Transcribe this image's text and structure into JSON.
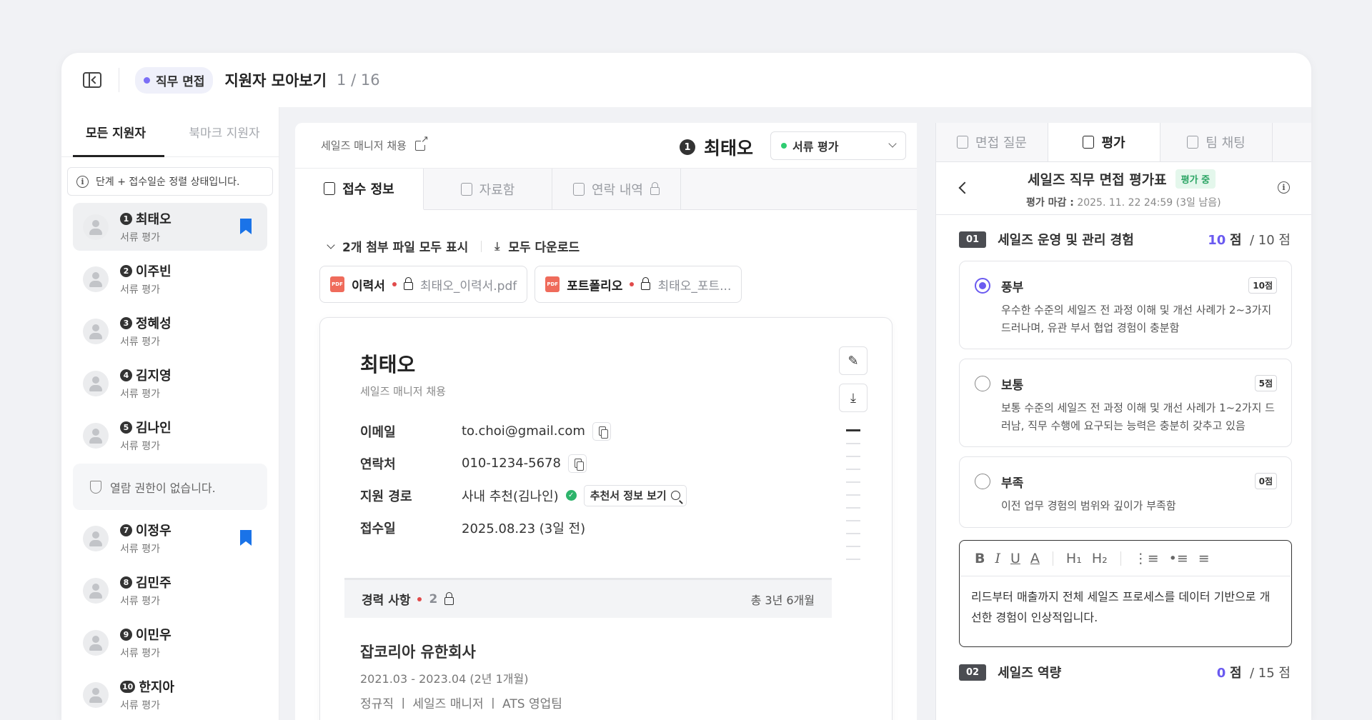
{
  "topbar": {
    "stage_chip": "직무 면접",
    "title": "지원자 모아보기",
    "counter": "1 / 16"
  },
  "sidebar": {
    "tabs": [
      "모든 지원자",
      "북마크 지원자"
    ],
    "sort_note": "단계 + 접수일순 정렬 상태입니다.",
    "applicants": [
      {
        "num": "1",
        "name": "최태오",
        "status": "서류 평가",
        "bookmarked": true,
        "selected": true
      },
      {
        "num": "2",
        "name": "이주빈",
        "status": "서류 평가"
      },
      {
        "num": "3",
        "name": "정혜성",
        "status": "서류 평가"
      },
      {
        "num": "4",
        "name": "김지영",
        "status": "서류 평가"
      },
      {
        "num": "5",
        "name": "김나인",
        "status": "서류 평가"
      },
      {
        "num": "7",
        "name": "이정우",
        "status": "서류 평가",
        "bookmarked": true
      },
      {
        "num": "8",
        "name": "김민주",
        "status": "서류 평가"
      },
      {
        "num": "9",
        "name": "이민우",
        "status": "서류 평가"
      },
      {
        "num": "10",
        "name": "한지아",
        "status": "서류 평가"
      }
    ],
    "no_permission": "열람 권한이 없습니다."
  },
  "center": {
    "job": "세일즈 매니저 채용",
    "applicant_num": "1",
    "applicant_name": "최태오",
    "status_select": "서류 평가",
    "tabs": [
      "접수 정보",
      "자료함",
      "연락 내역"
    ],
    "attach_toggle": "2개 첨부 파일 모두 표시",
    "download_all": "모두 다운로드",
    "files": [
      {
        "label": "이력서",
        "name": "최태오_이력서.pdf",
        "type": "PDF"
      },
      {
        "label": "포트폴리오",
        "name": "최태오_포트...",
        "type": "PDF"
      }
    ],
    "card": {
      "name": "최태오",
      "job": "세일즈 매니저 채용",
      "rows": [
        {
          "label": "이메일",
          "value": "to.choi@gmail.com"
        },
        {
          "label": "연락처",
          "value": "010-1234-5678"
        },
        {
          "label": "지원 경로",
          "value": "사내 추천(김나인)",
          "ref_button": "추천서 정보 보기"
        },
        {
          "label": "접수일",
          "value": "2025.08.23 (3일 전)"
        }
      ],
      "career": {
        "title": "경력 사항",
        "count": "2",
        "total": "총 3년 6개월",
        "company": "잡코리아 유한회사",
        "period": "2021.03 - 2023.04 (2년 1개월)",
        "roles": "정규직  ㅣ 세일즈 매니저  ㅣ ATS 영업팀"
      }
    }
  },
  "right": {
    "tabs": [
      "면접 질문",
      "평가",
      "팀 채팅"
    ],
    "eval_title": "세일즈 직무 면접 평가표",
    "eval_badge": "평가 중",
    "deadline_label": "평가 마감 :",
    "deadline_value": "2025. 11. 22 24:59 (3일 남음)",
    "sections": [
      {
        "num": "01",
        "title": "세일즈 운영 및 관리 경험",
        "score": "10",
        "score_unit": "점",
        "max": "/ 10 점"
      },
      {
        "num": "02",
        "title": "세일즈 역량",
        "score": "0",
        "score_unit": "점",
        "max": "/ 15 점"
      }
    ],
    "options": [
      {
        "title": "풍부",
        "points": "10점",
        "desc": "우수한 수준의 세일즈 전 과정 이해 및 개선 사례가 2~3가지 드러나며, 유관 부서 협업 경험이 충분함",
        "checked": true
      },
      {
        "title": "보통",
        "points": "5점",
        "desc": "보통 수준의 세일즈 전 과정 이해 및 개선 사례가 1~2가지 드러남, 직무 수행에 요구되는 능력은 충분히 갖추고 있음"
      },
      {
        "title": "부족",
        "points": "0점",
        "desc": "이전 업무 경험의 범위와 깊이가 부족함"
      }
    ],
    "editor_text": "리드부터 매출까지 전체 세일즈 프로세스를 데이터 기반으로 개선한 경험이 인상적입니다."
  }
}
